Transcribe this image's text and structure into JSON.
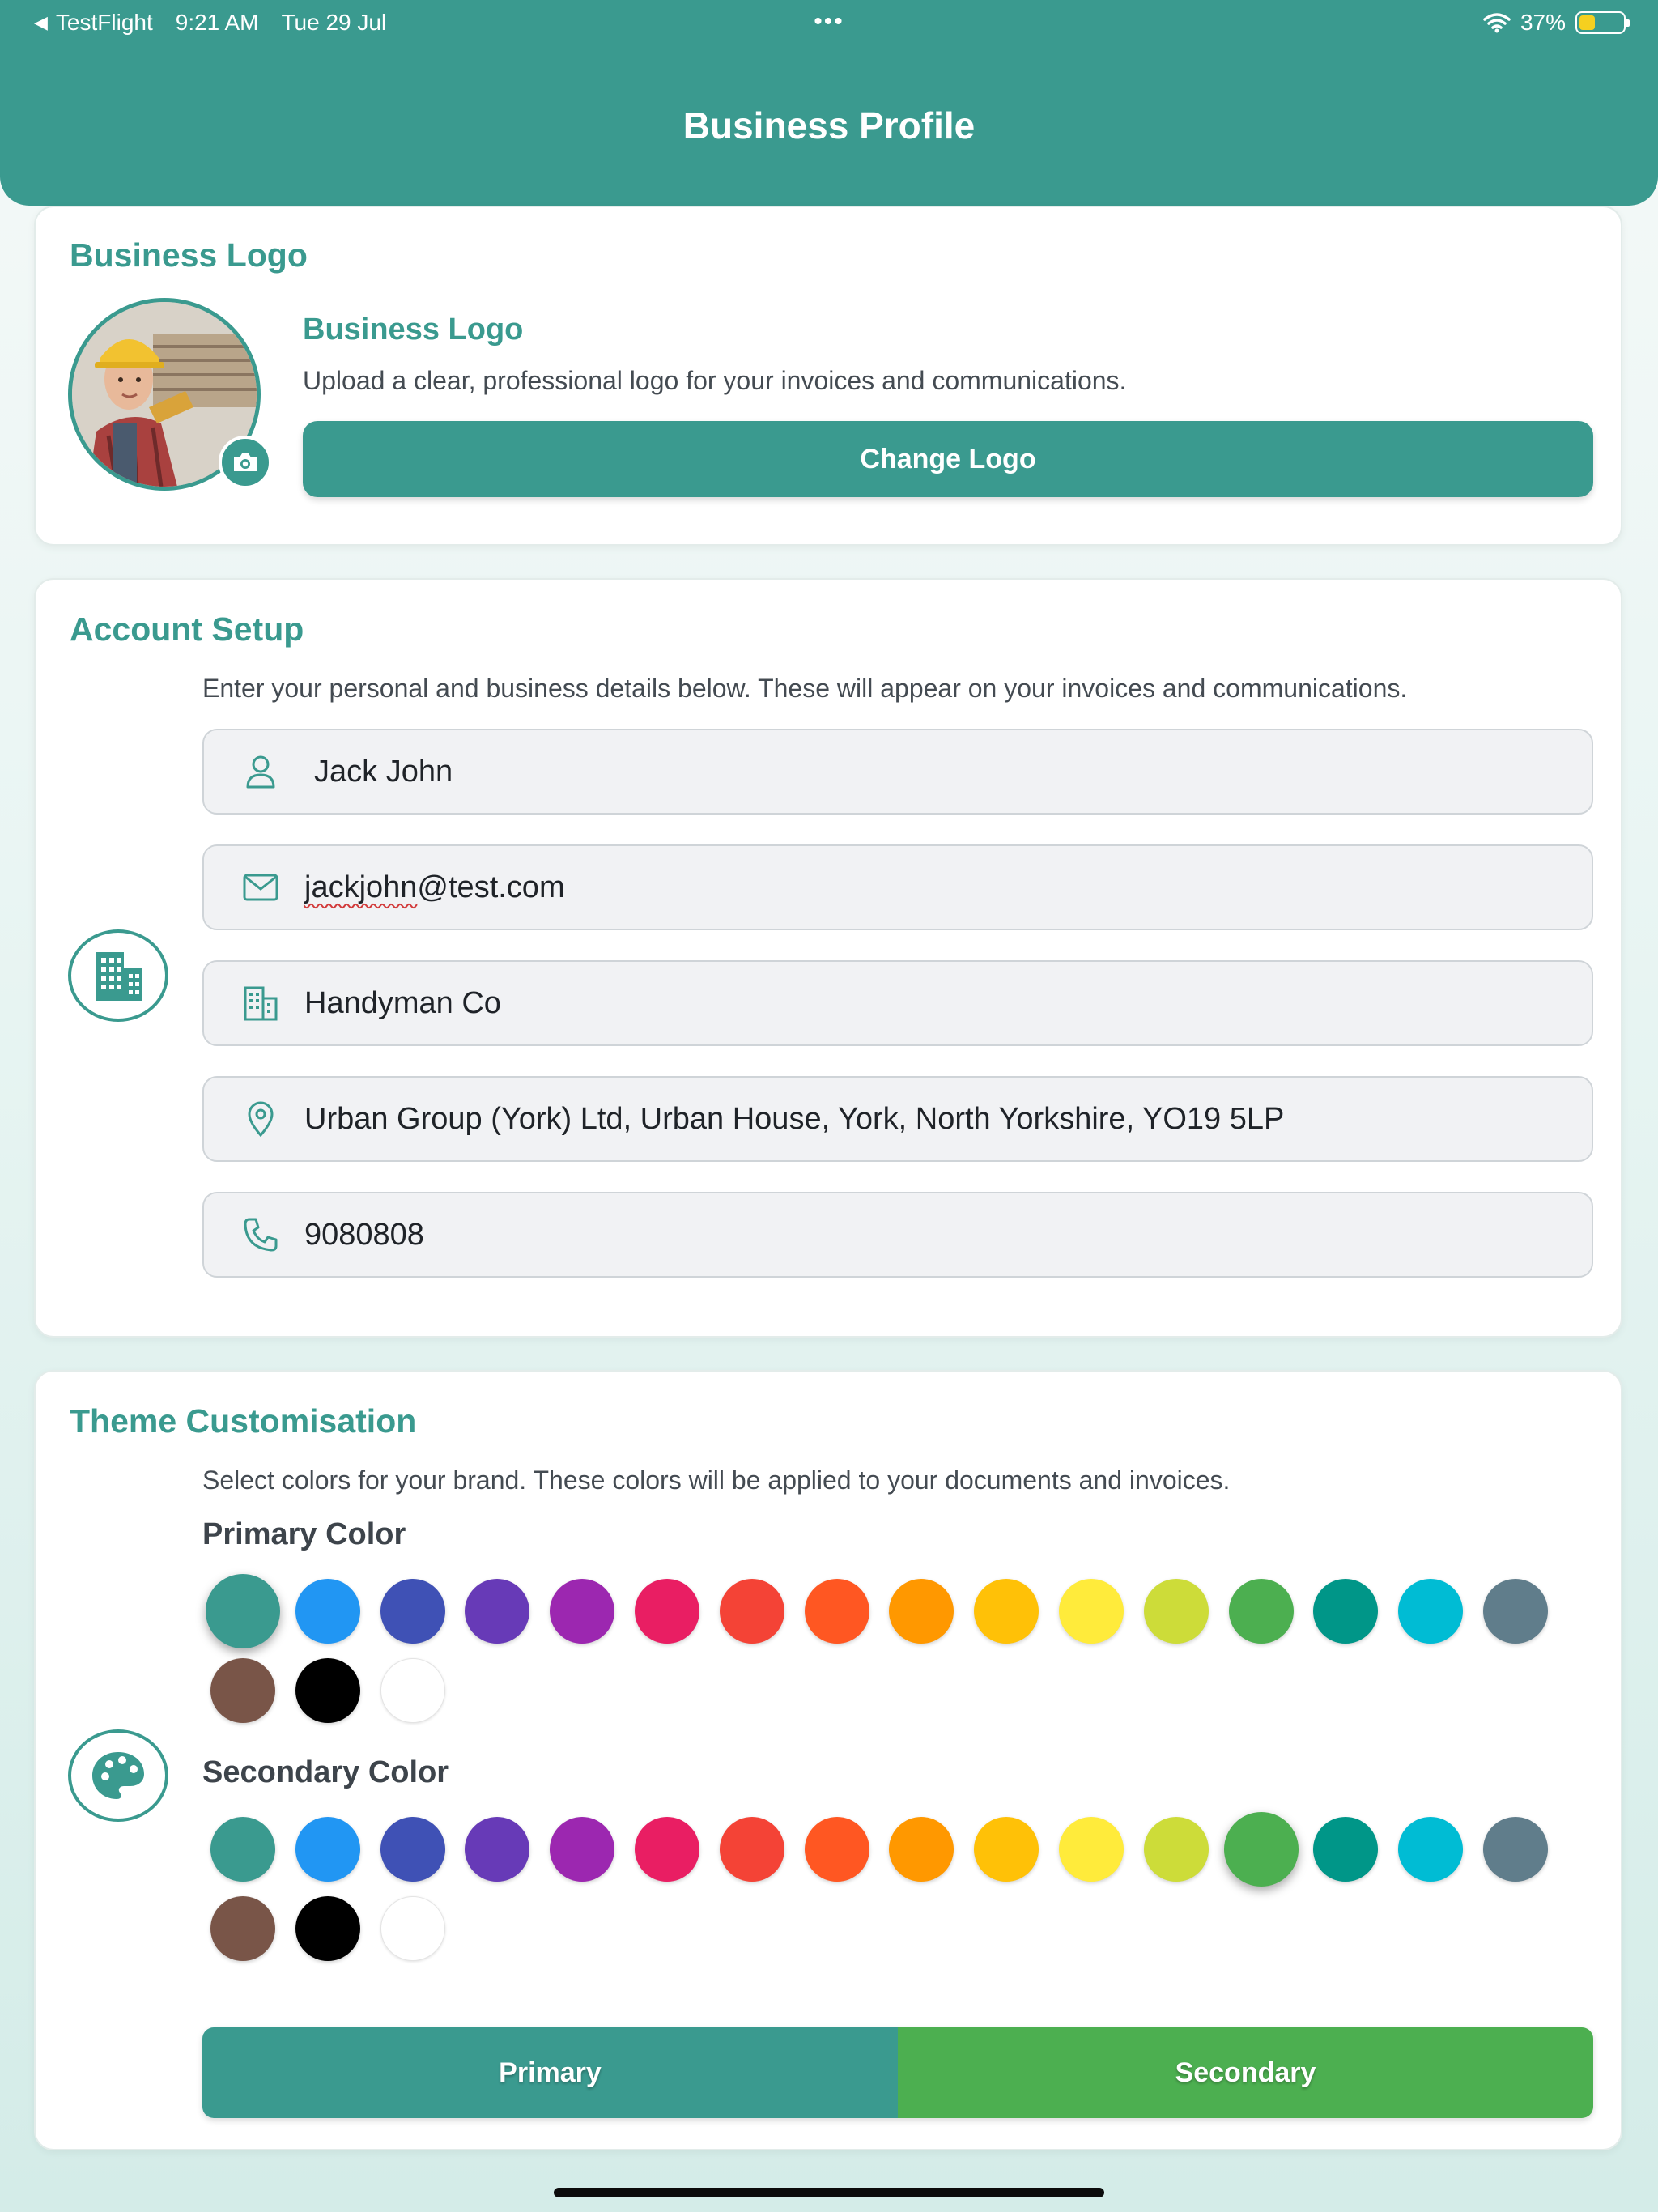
{
  "status_bar": {
    "back_app": "TestFlight",
    "time": "9:21 AM",
    "date": "Tue 29 Jul",
    "battery": "37%",
    "battery_level": 0.37
  },
  "header": {
    "title": "Business Profile"
  },
  "logo_section": {
    "title": "Business Logo",
    "subtitle": "Business Logo",
    "description": "Upload a clear, professional logo for your invoices and communications.",
    "button": "Change Logo"
  },
  "account_section": {
    "title": "Account Setup",
    "description": "Enter your personal and business details below. These will appear on your invoices and communications.",
    "fields": {
      "name": "Jack John",
      "email": "jackjohn@test.com",
      "business": "Handyman Co",
      "address": "Urban Group (York) Ltd, Urban House, York, North Yorkshire, YO19 5LP",
      "phone": "9080808"
    }
  },
  "theme_section": {
    "title": "Theme Customisation",
    "description": "Select colors for your brand. These colors will be applied to your documents and invoices.",
    "primary_label": "Primary Color",
    "secondary_label": "Secondary Color",
    "palette": [
      "#3a9a8f",
      "#2196f3",
      "#3f51b5",
      "#673ab7",
      "#9c27b0",
      "#e91e63",
      "#f44336",
      "#ff5722",
      "#ff9800",
      "#ffc107",
      "#ffeb3b",
      "#cddc39",
      "#4caf50",
      "#009688",
      "#00bcd4",
      "#607d8b",
      "#795548",
      "#000000",
      "#ffffff"
    ],
    "primary_selected": 0,
    "secondary_selected": 12,
    "preview_primary": "Primary",
    "preview_secondary": "Secondary"
  },
  "colors": {
    "accent": "#3a9a8f",
    "secondary": "#4caf50"
  }
}
